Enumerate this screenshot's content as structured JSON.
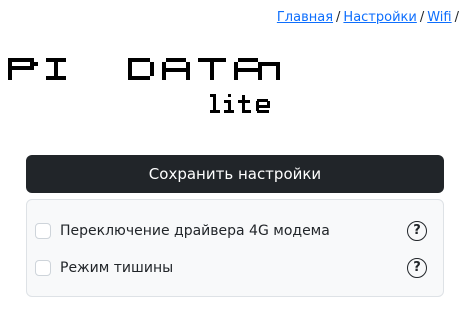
{
  "breadcrumb": {
    "items": [
      {
        "label": "Главная"
      },
      {
        "label": "Настройки"
      },
      {
        "label": "Wifi"
      }
    ],
    "separator": "/"
  },
  "logo": {
    "title": "PI DATA",
    "subtitle": "lite"
  },
  "save_button": {
    "label": "Сохранить настройки"
  },
  "settings": {
    "items": [
      {
        "label": "Переключение драйвера 4G модема",
        "checked": false,
        "help_icon": "question-circle-icon"
      },
      {
        "label": "Режим тишины",
        "checked": false,
        "help_icon": "question-circle-icon"
      }
    ]
  },
  "colors": {
    "link": "#0d6efd",
    "button_bg": "#212529",
    "panel_bg": "#f8f9fa",
    "panel_border": "#dee2e6"
  }
}
